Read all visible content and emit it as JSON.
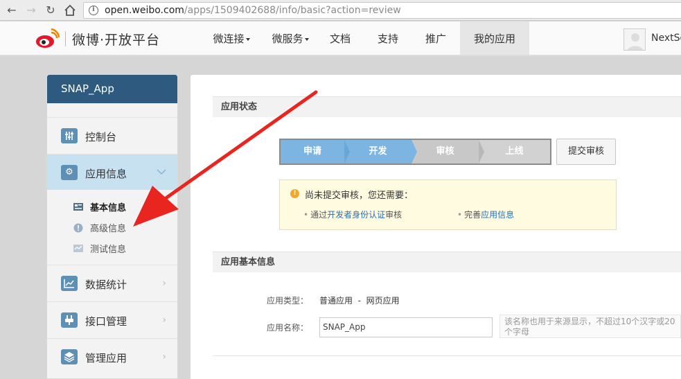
{
  "browser": {
    "url_host": "open.weibo.com",
    "url_path": "/apps/1509402688/info/basic?action=review"
  },
  "header": {
    "logo_text": "微博·开放平台",
    "nav": [
      "微连接",
      "微服务",
      "文档",
      "支持",
      "推广",
      "我的应用"
    ],
    "user_name": "NextSc"
  },
  "sidebar": {
    "app_name": "SNAP_App",
    "items": [
      {
        "label": "控制台",
        "icon": "dashboard-icon"
      },
      {
        "label": "应用信息",
        "icon": "gear-icon"
      },
      {
        "label": "数据统计",
        "icon": "chart-icon"
      },
      {
        "label": "接口管理",
        "icon": "plug-icon"
      },
      {
        "label": "管理应用",
        "icon": "layers-icon"
      }
    ],
    "subitems": [
      {
        "label": "基本信息",
        "icon": "card-icon"
      },
      {
        "label": "高级信息",
        "icon": "alert-icon"
      },
      {
        "label": "测试信息",
        "icon": "test-icon"
      }
    ]
  },
  "status_section": {
    "title": "应用状态",
    "steps": [
      "申请",
      "开发",
      "审核",
      "上线"
    ],
    "completed_steps": 2,
    "submit_button": "提交审核",
    "notice": {
      "title": "尚未提交审核，您还需要：",
      "line1": {
        "prefix": "通过",
        "link": "开发者身份认证",
        "suffix": "审核"
      },
      "line2": {
        "prefix": "完善",
        "link": "应用信息"
      }
    }
  },
  "basic_section": {
    "title": "应用基本信息",
    "type_label": "应用类型：",
    "type_value": "普通应用  -  网页应用",
    "name_label": "应用名称：",
    "name_value": "SNAP_App",
    "name_hint": "该名称也用于来源显示，不超过10个汉字或20个字母"
  },
  "colors": {
    "sidebar_head": "#2d5a7e",
    "sidebar_active": "#c7e1f0",
    "step_done": "#7cb5e2",
    "step_todo": "#c8c8c8",
    "link": "#2b6fb6",
    "annotation_arrow": "#e8261f"
  }
}
